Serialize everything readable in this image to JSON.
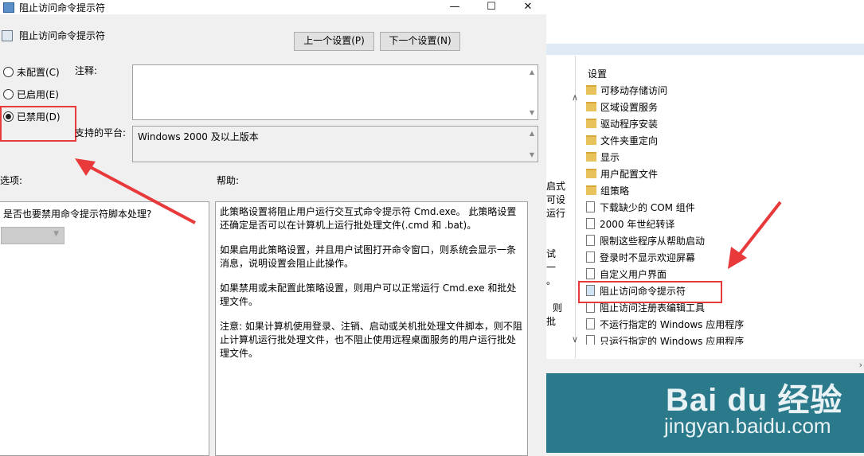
{
  "dialog": {
    "title": "阻止访问命令提示符",
    "policy_name": "阻止访问命令提示符",
    "prev_button": "上一个设置(P)",
    "next_button": "下一个设置(N)",
    "radio_not_configured": "未配置(C)",
    "radio_enabled": "已启用(E)",
    "radio_disabled": "已禁用(D)",
    "comment_label": "注释:",
    "supported_label": "支持的平台:",
    "supported_value": "Windows 2000 及以上版本",
    "options_label": "选项:",
    "help_label": "帮助:",
    "option_question": "是否也要禁用命令提示符脚本处理?",
    "help_paragraphs": [
      "此策略设置将阻止用户运行交互式命令提示符 Cmd.exe。 此策略设置还确定是否可以在计算机上运行批处理文件(.cmd 和 .bat)。",
      "如果启用此策略设置，并且用户试图打开命令窗口，则系统会显示一条消息，说明设置会阻止此操作。",
      "如果禁用或未配置此策略设置，则用户可以正常运行 Cmd.exe 和批处理文件。",
      "注意: 如果计算机使用登录、注销、启动或关机批处理文件脚本，则不阻止计算机运行批处理文件，也不阻止使用远程桌面服务的用户运行批处理文件。"
    ]
  },
  "right_window": {
    "header": "设置",
    "items": [
      {
        "label": "可移动存储访问",
        "type": "folder"
      },
      {
        "label": "区域设置服务",
        "type": "folder"
      },
      {
        "label": "驱动程序安装",
        "type": "folder"
      },
      {
        "label": "文件夹重定向",
        "type": "folder"
      },
      {
        "label": "显示",
        "type": "folder"
      },
      {
        "label": "用户配置文件",
        "type": "folder"
      },
      {
        "label": "组策略",
        "type": "folder"
      },
      {
        "label": "下载缺少的 COM 组件",
        "type": "doc"
      },
      {
        "label": "2000 年世纪转译",
        "type": "doc"
      },
      {
        "label": "限制这些程序从帮助启动",
        "type": "doc"
      },
      {
        "label": "登录时不显示欢迎屏幕",
        "type": "doc"
      },
      {
        "label": "自定义用户界面",
        "type": "doc"
      },
      {
        "label": "阻止访问命令提示符",
        "type": "doc"
      },
      {
        "label": "阻止访问注册表编辑工具",
        "type": "doc"
      },
      {
        "label": "不运行指定的 Windows 应用程序",
        "type": "doc"
      },
      {
        "label": "只运行指定的 Windows 应用程序",
        "type": "doc"
      }
    ],
    "cut_text": [
      "启式",
      "可设",
      "运行",
      "试",
      "一",
      "。",
      "则",
      "批"
    ]
  },
  "watermark": {
    "brand": "Bai du 经验",
    "url": "jingyan.baidu.com"
  },
  "colors": {
    "highlight": "#e8393b",
    "dialog_bg": "#f0f0f0"
  }
}
